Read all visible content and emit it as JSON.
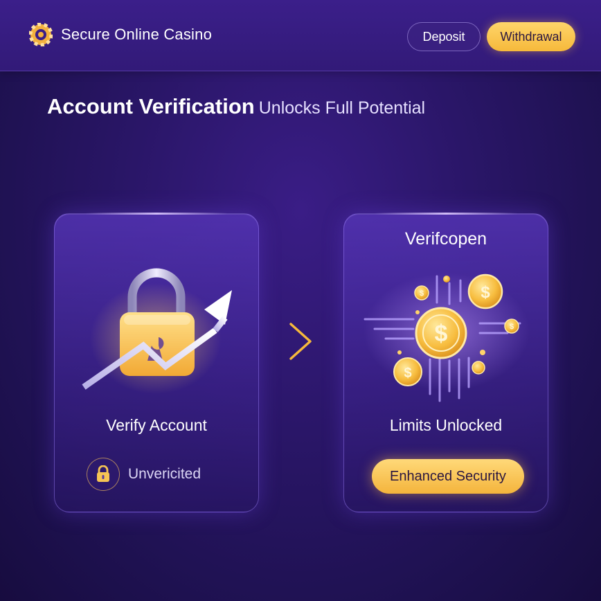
{
  "header": {
    "brand_name": "Secure Online Casino",
    "logo_icon": "casino-chip-icon",
    "buttons": {
      "deposit_label": "Deposit",
      "withdrawal_label": "Withdrawal"
    }
  },
  "headline": {
    "strong": "Account Verification",
    "light": "Unlocks Full Potential"
  },
  "cards": {
    "left": {
      "art_icon": "padlock-growth-icon",
      "label": "Verify Account",
      "status_icon": "padlock-icon",
      "status_text": "Unvericited"
    },
    "right": {
      "title": "Verifcopen",
      "art_icon": "gold-coins-icon",
      "label": "Limits Unlocked",
      "button_label": "Enhanced Security"
    }
  },
  "connector_icon": "chevron-right-icon",
  "colors": {
    "background": "#241360",
    "accent_gold": "#f6b93b",
    "card": "#4a2aa0",
    "text": "#ffffff"
  }
}
